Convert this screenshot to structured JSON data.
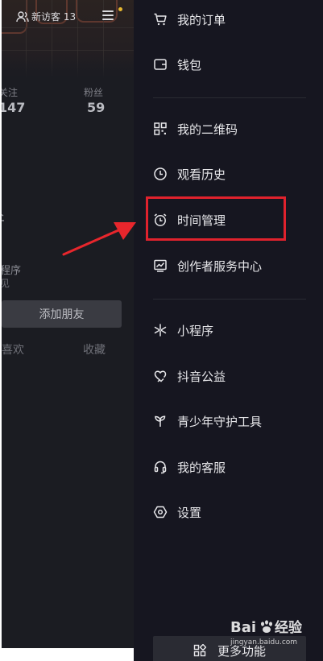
{
  "profile": {
    "visitor_label": "新访客 13",
    "following_label": "关注",
    "following_count": "147",
    "fans_label": "粉丝",
    "fans_count": "59",
    "mini_program_partial": "程序",
    "mini_program_sub_partial": "见",
    "add_friend_label": "添加朋友",
    "tab_likes_partial": "喜欢",
    "tab_favorites": "收藏"
  },
  "drawer": {
    "items": [
      {
        "label": "我的订单",
        "icon": "shopping-cart-icon"
      },
      {
        "label": "钱包",
        "icon": "wallet-icon"
      },
      {
        "label": "我的二维码",
        "icon": "qr-code-icon"
      },
      {
        "label": "观看历史",
        "icon": "clock-icon"
      },
      {
        "label": "时间管理",
        "icon": "alarm-clock-icon"
      },
      {
        "label": "创作者服务中心",
        "icon": "chart-icon"
      },
      {
        "label": "小程序",
        "icon": "asterisk-icon"
      },
      {
        "label": "抖音公益",
        "icon": "heart-hand-icon"
      },
      {
        "label": "青少年守护工具",
        "icon": "sprout-icon"
      },
      {
        "label": "我的客服",
        "icon": "headset-icon"
      },
      {
        "label": "设置",
        "icon": "hexagon-settings-icon"
      }
    ],
    "more_label": "更多功能",
    "highlighted_item": "时间管理"
  },
  "watermark": {
    "brand": "Baidu经验",
    "url": "jingyan.baidu.com"
  },
  "colors": {
    "drawer_bg": "#161620",
    "left_bg": "#1b1c22",
    "highlight": "#e0222d",
    "arrow": "#e8262c"
  }
}
